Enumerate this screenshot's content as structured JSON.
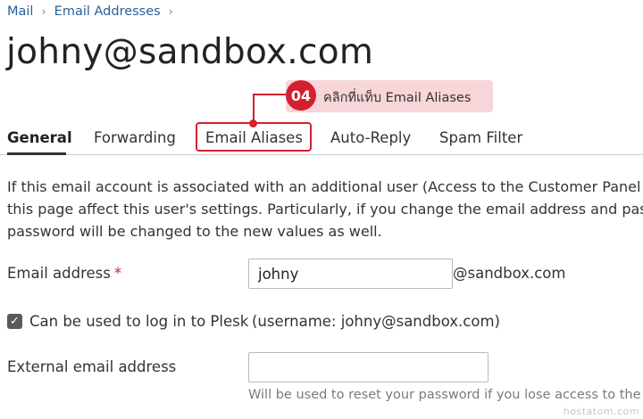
{
  "breadcrumb": {
    "items": [
      "Mail",
      "Email Addresses"
    ],
    "separator": "›"
  },
  "page": {
    "title": "johny@sandbox.com"
  },
  "tabs": [
    {
      "label": "General",
      "active": true
    },
    {
      "label": "Forwarding",
      "active": false
    },
    {
      "label": "Email Aliases",
      "active": false
    },
    {
      "label": "Auto-Reply",
      "active": false
    },
    {
      "label": "Spam Filter",
      "active": false
    }
  ],
  "callout": {
    "step": "04",
    "text": "คลิกที่แท็บ Email Aliases",
    "color": "#d4202e",
    "bg": "#f7d5d8"
  },
  "info": {
    "lines": [
      "If this email account is associated with an additional user (Access to the Customer Panel",
      "this page affect this user's settings. Particularly, if you change the email address and pas",
      "password will be changed to the new values as well."
    ]
  },
  "form": {
    "email_label": "Email address",
    "required_mark": "*",
    "email_value": "johny",
    "email_domain": "@sandbox.com",
    "login_checkbox_label": "Can be used to log in to Plesk",
    "login_checked": true,
    "login_note": "(username: johny@sandbox.com)",
    "external_label": "External email address",
    "external_value": "",
    "external_hint": "Will be used to reset your password if you lose access to the pri"
  },
  "watermark": "hostatom.com",
  "colors": {
    "link": "#28609c",
    "accent": "#d4202e"
  }
}
